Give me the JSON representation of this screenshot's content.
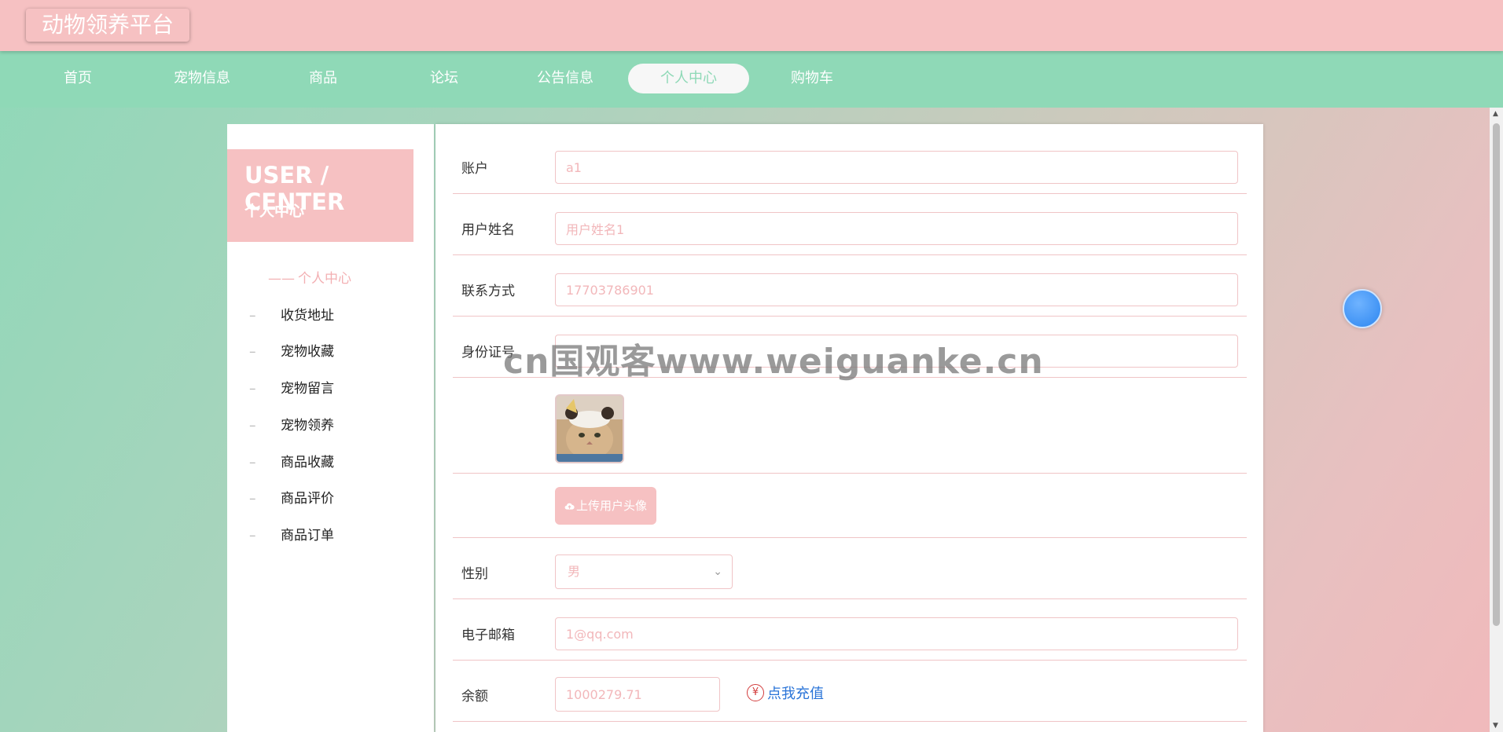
{
  "brand": "动物领养平台",
  "nav": [
    {
      "label": "首页"
    },
    {
      "label": "宠物信息"
    },
    {
      "label": "商品"
    },
    {
      "label": "论坛"
    },
    {
      "label": "公告信息"
    },
    {
      "label": "个人中心",
      "active": true
    },
    {
      "label": "购物车"
    }
  ],
  "sidebar": {
    "title_en": "USER / CENTER",
    "title_cn": "个人中心",
    "current": "个人中心",
    "items": [
      "收货地址",
      "宠物收藏",
      "宠物留言",
      "宠物领养",
      "商品收藏",
      "商品评价",
      "商品订单"
    ]
  },
  "form": {
    "account": {
      "label": "账户",
      "value": "a1"
    },
    "name": {
      "label": "用户姓名",
      "value": "用户姓名1"
    },
    "phone": {
      "label": "联系方式",
      "value": "17703786901"
    },
    "id_card": {
      "label": "身份证号",
      "value": ""
    },
    "upload_label": "上传用户头像",
    "gender": {
      "label": "性别",
      "value": "男"
    },
    "email": {
      "label": "电子邮箱",
      "value": "1@qq.com"
    },
    "balance": {
      "label": "余额",
      "value": "1000279.71"
    },
    "recharge_label": "点我充值"
  },
  "watermark": "cn国观客www.weiguanke.cn",
  "colors": {
    "pink": "#f6c1c2",
    "green": "#8fd9b7",
    "link": "#2a74d8"
  },
  "icons": {
    "upload": "cloud-upload-icon",
    "yen": "yen-icon",
    "select": "chevron-down-icon"
  }
}
